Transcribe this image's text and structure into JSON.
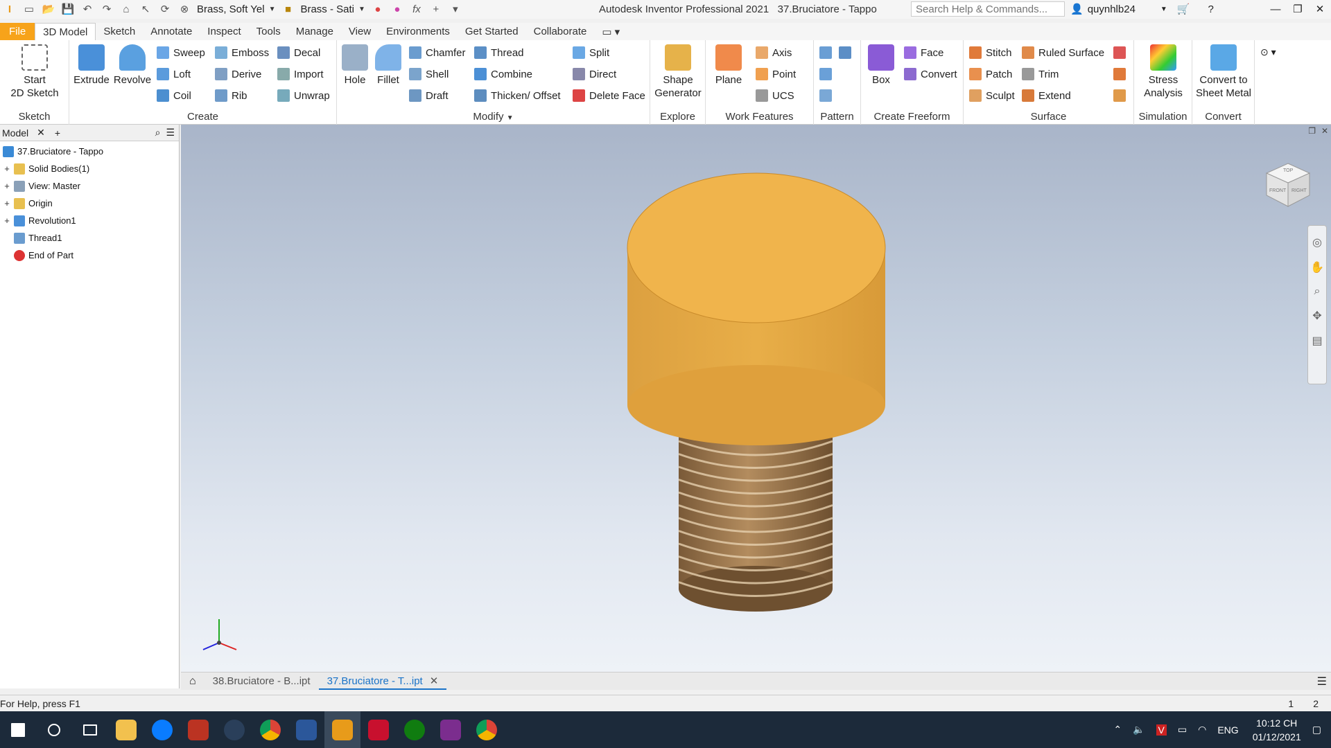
{
  "window": {
    "title": "Autodesk Inventor Professional 2021",
    "document": "37.Bruciatore - Tappo",
    "search_placeholder": "Search Help & Commands...",
    "user": "quynhlb24"
  },
  "quick_access": {
    "material": "Brass, Soft Yel",
    "appearance": "Brass - Sati"
  },
  "tabs": [
    "File",
    "3D Model",
    "Sketch",
    "Annotate",
    "Inspect",
    "Tools",
    "Manage",
    "View",
    "Environments",
    "Get Started",
    "Collaborate"
  ],
  "ribbon": {
    "sketch": {
      "title": "Sketch",
      "start": "Start",
      "start2": "2D Sketch"
    },
    "create": {
      "title": "Create",
      "extrude": "Extrude",
      "revolve": "Revolve",
      "sweep": "Sweep",
      "emboss": "Emboss",
      "decal": "Decal",
      "loft": "Loft",
      "derive": "Derive",
      "import": "Import",
      "coil": "Coil",
      "rib": "Rib",
      "unwrap": "Unwrap"
    },
    "modify": {
      "title": "Modify",
      "hole": "Hole",
      "fillet": "Fillet",
      "chamfer": "Chamfer",
      "thread": "Thread",
      "split": "Split",
      "shell": "Shell",
      "combine": "Combine",
      "direct": "Direct",
      "draft": "Draft",
      "thicken": "Thicken/ Offset",
      "delete_face": "Delete Face"
    },
    "explore": {
      "title": "Explore",
      "shape": "Shape",
      "generator": "Generator"
    },
    "work": {
      "title": "Work Features",
      "plane": "Plane",
      "axis": "Axis",
      "point": "Point",
      "ucs": "UCS"
    },
    "pattern": {
      "title": "Pattern"
    },
    "freeform": {
      "title": "Create Freeform",
      "box": "Box",
      "face": "Face",
      "convert": "Convert"
    },
    "surface": {
      "title": "Surface",
      "stitch": "Stitch",
      "ruled": "Ruled Surface",
      "patch": "Patch",
      "trim": "Trim",
      "sculpt": "Sculpt",
      "extend": "Extend"
    },
    "simulation": {
      "title": "Simulation",
      "stress": "Stress",
      "analysis": "Analysis"
    },
    "convert": {
      "title": "Convert",
      "convert_to": "Convert to",
      "sheet_metal": "Sheet Metal"
    }
  },
  "browser": {
    "tab": "Model",
    "items": [
      {
        "label": "37.Bruciatore - Tappo",
        "icon": "part-icon"
      },
      {
        "label": "Solid Bodies(1)",
        "icon": "folder-icon"
      },
      {
        "label": "View: Master",
        "icon": "view-icon"
      },
      {
        "label": "Origin",
        "icon": "folder-icon"
      },
      {
        "label": "Revolution1",
        "icon": "revolve-icon"
      },
      {
        "label": "Thread1",
        "icon": "thread-icon"
      },
      {
        "label": "End of Part",
        "icon": "end-of-part-icon"
      }
    ]
  },
  "viewcube": {
    "top": "TOP",
    "front": "FRONT",
    "right": "RIGHT"
  },
  "doc_tabs": [
    "38.Bruciatore - B...ipt",
    "37.Bruciatore - T...ipt"
  ],
  "status": {
    "help": "For Help, press F1",
    "n1": "1",
    "n2": "2"
  },
  "taskbar": {
    "lang": "ENG",
    "time": "10:12 CH",
    "date": "01/12/2021"
  },
  "colors": {
    "file_tab": "#f7a31a",
    "accent": "#1a73c8",
    "part_top": "#f0b44c",
    "part_side": "#e3a33c"
  }
}
